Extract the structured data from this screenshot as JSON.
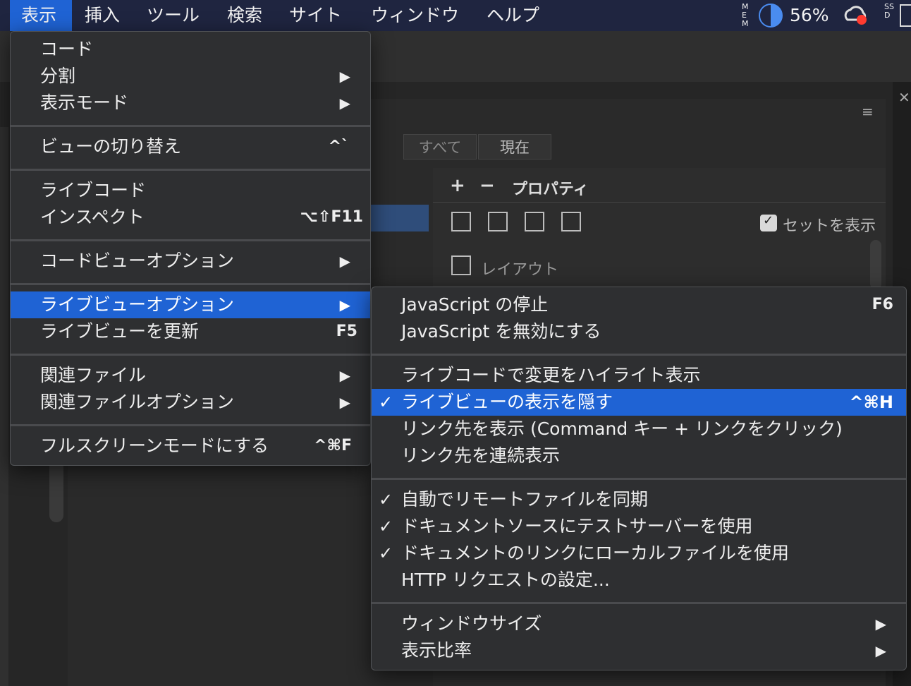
{
  "menubar": {
    "items": [
      "表示",
      "挿入",
      "ツール",
      "検索",
      "サイト",
      "ウィンドウ",
      "ヘルプ"
    ],
    "active_index": 0,
    "status": {
      "mem_label": "MEM",
      "mem_percent_text": "56%",
      "ssd_label": "SSD"
    }
  },
  "background": {
    "segments": [
      "すべて",
      "現在"
    ],
    "properties_label": "プロパティ",
    "plus": "+",
    "minus": "−",
    "show_set_label": "セットを表示",
    "layout_label": "レイアウト",
    "close_glyph": "✕"
  },
  "view_menu": {
    "items": [
      {
        "label": "コード",
        "shortcut": "",
        "submenu": false
      },
      {
        "label": "分割",
        "shortcut": "",
        "submenu": true
      },
      {
        "label": "表示モード",
        "shortcut": "",
        "submenu": true
      },
      {
        "label": "ビューの切り替え",
        "shortcut": "^`",
        "submenu": false
      },
      {
        "label": "ライブコード",
        "shortcut": "",
        "submenu": false
      },
      {
        "label": "インスペクト",
        "shortcut": "⌥⇧F11",
        "submenu": false
      },
      {
        "label": "コードビューオプション",
        "shortcut": "",
        "submenu": true
      },
      {
        "label": "ライブビューオプション",
        "shortcut": "",
        "submenu": true,
        "highlighted": true
      },
      {
        "label": "ライブビューを更新",
        "shortcut": "F5",
        "submenu": false
      },
      {
        "label": "関連ファイル",
        "shortcut": "",
        "submenu": true
      },
      {
        "label": "関連ファイルオプション",
        "shortcut": "",
        "submenu": true
      },
      {
        "label": "フルスクリーンモードにする",
        "shortcut": "^⌘F",
        "submenu": false
      }
    ]
  },
  "live_view_submenu": {
    "items": [
      {
        "label": "JavaScript の停止",
        "shortcut": "F6",
        "checked": false,
        "submenu": false
      },
      {
        "label": "JavaScript を無効にする",
        "shortcut": "",
        "checked": false,
        "submenu": false
      },
      {
        "label": "ライブコードで変更をハイライト表示",
        "shortcut": "",
        "checked": false,
        "submenu": false
      },
      {
        "label": "ライブビューの表示を隠す",
        "shortcut": "^⌘H",
        "checked": true,
        "submenu": false,
        "highlighted": true
      },
      {
        "label": "リンク先を表示 (Command キー + リンクをクリック)",
        "shortcut": "",
        "checked": false,
        "submenu": false
      },
      {
        "label": "リンク先を連続表示",
        "shortcut": "",
        "checked": false,
        "submenu": false
      },
      {
        "label": "自動でリモートファイルを同期",
        "shortcut": "",
        "checked": true,
        "submenu": false
      },
      {
        "label": "ドキュメントソースにテストサーバーを使用",
        "shortcut": "",
        "checked": true,
        "submenu": false
      },
      {
        "label": "ドキュメントのリンクにローカルファイルを使用",
        "shortcut": "",
        "checked": true,
        "submenu": false
      },
      {
        "label": "HTTP リクエストの設定...",
        "shortcut": "",
        "checked": false,
        "submenu": false
      },
      {
        "label": "ウィンドウサイズ",
        "shortcut": "",
        "checked": false,
        "submenu": true
      },
      {
        "label": "表示比率",
        "shortcut": "",
        "checked": false,
        "submenu": true
      }
    ],
    "check_glyph": "✓",
    "arrow_glyph": "▶"
  },
  "colors": {
    "highlight": "#1f63d4",
    "menubar": "#1f2540",
    "menu_bg": "#2e2f31"
  }
}
